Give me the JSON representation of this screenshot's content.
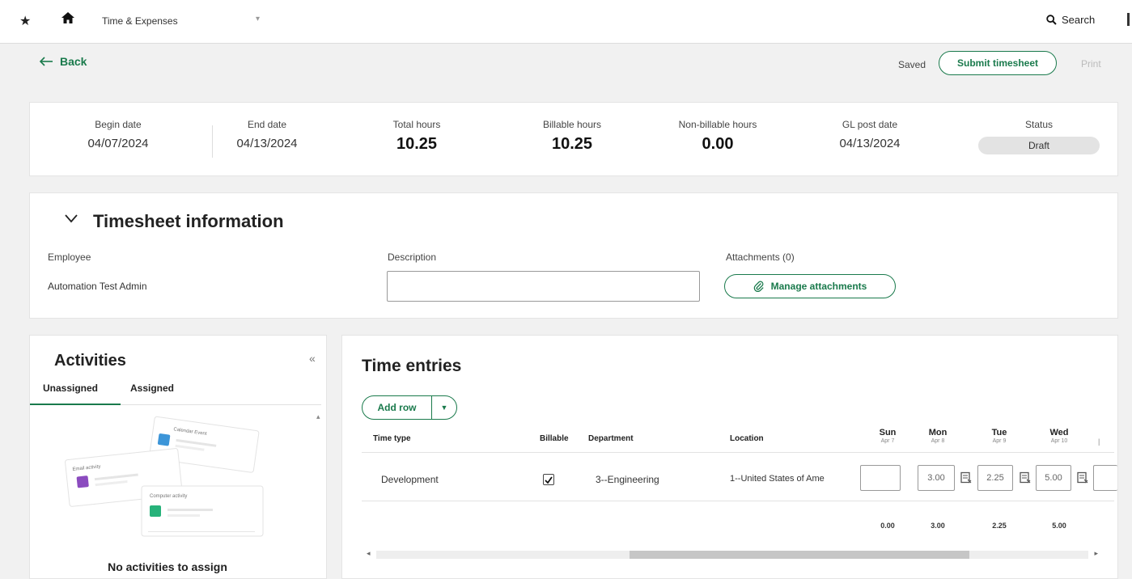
{
  "topbar": {
    "app_name": "Time & Expenses",
    "search_label": "Search"
  },
  "header": {
    "back_label": "Back",
    "saved_label": "Saved",
    "submit_label": "Submit timesheet",
    "print_label": "Print"
  },
  "summary": {
    "begin_date_label": "Begin date",
    "begin_date": "04/07/2024",
    "end_date_label": "End date",
    "end_date": "04/13/2024",
    "total_hours_label": "Total hours",
    "total_hours": "10.25",
    "billable_hours_label": "Billable hours",
    "billable_hours": "10.25",
    "nonbillable_hours_label": "Non-billable hours",
    "nonbillable_hours": "0.00",
    "gl_post_date_label": "GL post date",
    "gl_post_date": "04/13/2024",
    "status_label": "Status",
    "status": "Draft"
  },
  "timesheet_info": {
    "title": "Timesheet information",
    "employee_label": "Employee",
    "employee": "Automation Test Admin",
    "description_label": "Description",
    "description_value": "",
    "attachments_label": "Attachments (0)",
    "manage_attachments_label": "Manage attachments"
  },
  "activities": {
    "title": "Activities",
    "tabs": [
      {
        "label": "Unassigned",
        "active": true
      },
      {
        "label": "Assigned",
        "active": false
      }
    ],
    "illustration_cards": [
      "Calendar Event",
      "Email activity",
      "Computer activity"
    ],
    "empty_message": "No activities to assign"
  },
  "time_entries": {
    "title": "Time entries",
    "add_row_label": "Add row",
    "columns": [
      "Time type",
      "Billable",
      "Department",
      "Location"
    ],
    "days": [
      {
        "day": "Sun",
        "date": "Apr 7"
      },
      {
        "day": "Mon",
        "date": "Apr 8"
      },
      {
        "day": "Tue",
        "date": "Apr 9"
      },
      {
        "day": "Wed",
        "date": "Apr 10"
      }
    ],
    "row": {
      "time_type": "Development",
      "billable": true,
      "department": "3--Engineering",
      "location": "1--United States of Ame",
      "hours": [
        "",
        "3.00",
        "2.25",
        "5.00"
      ]
    },
    "totals": [
      "0.00",
      "3.00",
      "2.25",
      "5.00"
    ]
  },
  "colors": {
    "accent": "#1a7a4c",
    "card_bg": "#ffffff",
    "page_bg": "#f1f1f1"
  }
}
